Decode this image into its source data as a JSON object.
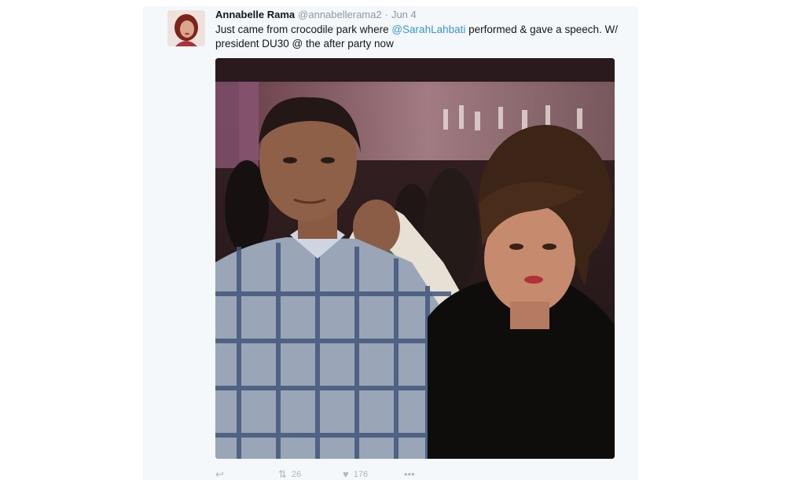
{
  "tweet": {
    "author_name": "Annabelle Rama",
    "handle": "@annabellerama2",
    "separator": "·",
    "date": "Jun 4",
    "text_before": "Just came from crocodile park where ",
    "mention": "@SarahLahbati",
    "text_after": " performed & gave a speech. W/ president DU30 @ the after party now"
  },
  "actions": {
    "reply_icon": "reply-icon",
    "retweet_icon": "retweet-icon",
    "retweet_count": "26",
    "like_icon": "heart-icon",
    "like_count": "176",
    "more_icon": "more-icon"
  },
  "colors": {
    "link": "#3b94d9",
    "muted": "#8899a6",
    "text": "#14171a"
  }
}
